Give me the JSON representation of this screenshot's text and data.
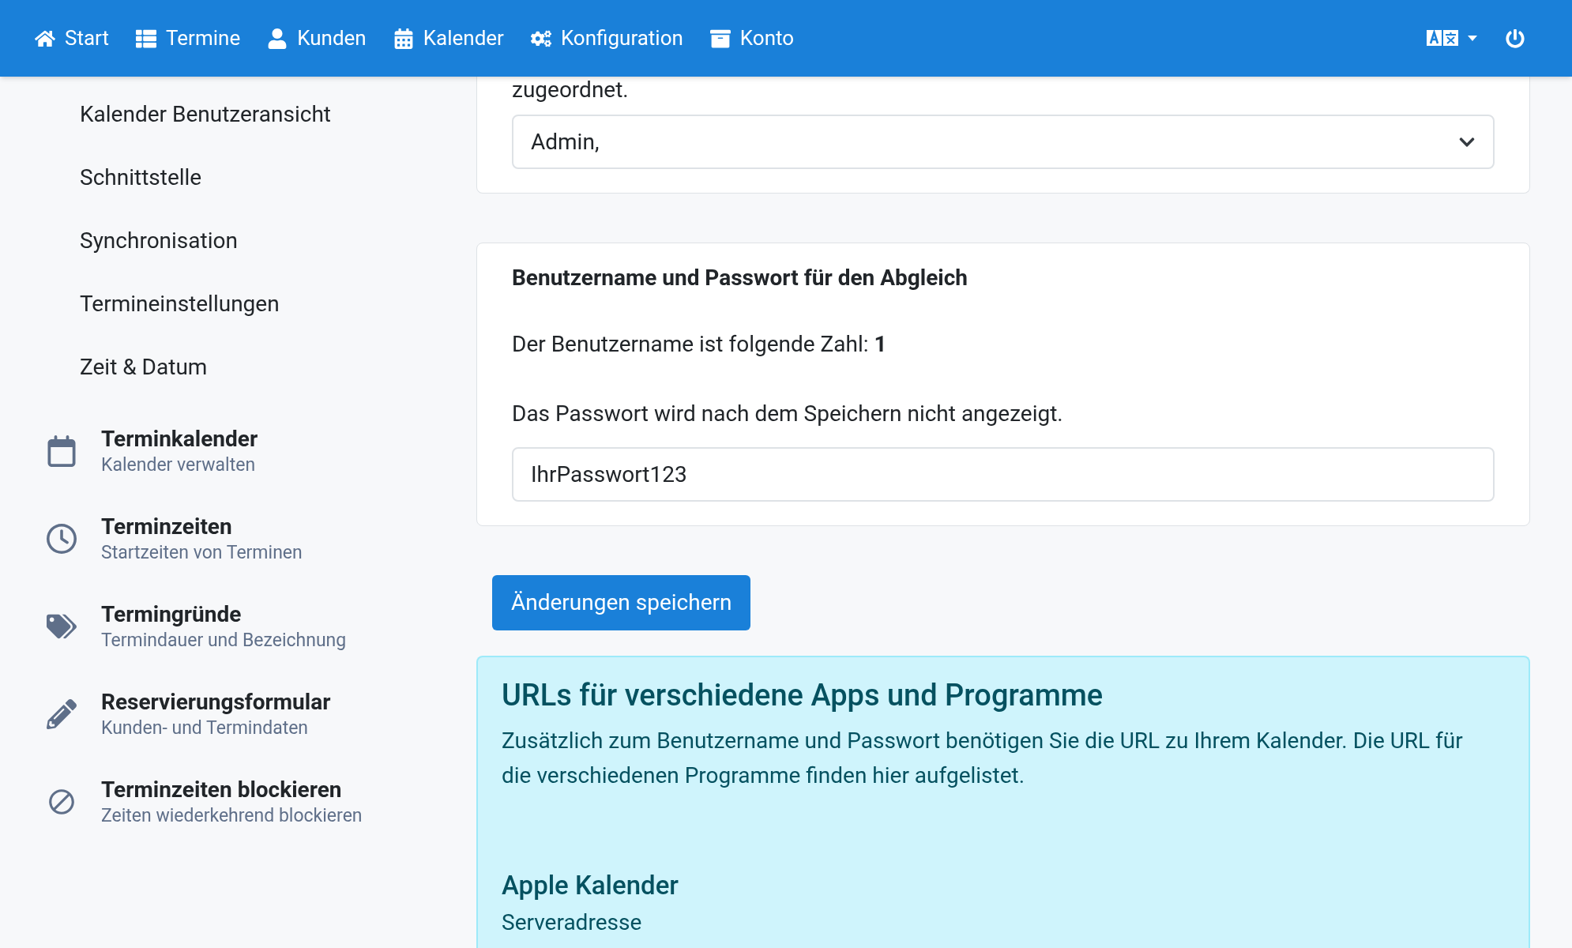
{
  "nav": {
    "items": [
      {
        "kind": "home",
        "label": "Start"
      },
      {
        "kind": "list",
        "label": "Termine"
      },
      {
        "kind": "user",
        "label": "Kunden"
      },
      {
        "kind": "calendar",
        "label": "Kalender"
      },
      {
        "kind": "gears",
        "label": "Konfiguration"
      },
      {
        "kind": "archive",
        "label": "Konto"
      }
    ]
  },
  "sidebar": {
    "subitems": [
      "Kalender Benutzeransicht",
      "Schnittstelle",
      "Synchronisation",
      "Termineinstellungen",
      "Zeit & Datum"
    ],
    "items": [
      {
        "kind": "calendar",
        "title": "Terminkalender",
        "subtitle": "Kalender verwalten"
      },
      {
        "kind": "clock",
        "title": "Terminzeiten",
        "subtitle": "Startzeiten von Terminen"
      },
      {
        "kind": "tags",
        "title": "Termingründe",
        "subtitle": "Termindauer und Bezeichnung"
      },
      {
        "kind": "pencil",
        "title": "Reservierungsformular",
        "subtitle": "Kunden- und Termindaten"
      },
      {
        "kind": "ban",
        "title": "Terminzeiten blockieren",
        "subtitle": "Zeiten wiederkehrend blockieren"
      }
    ]
  },
  "assignment_card": {
    "text": "zugeordnet.",
    "select_value": "Admin,"
  },
  "credentials_card": {
    "heading": "Benutzername und Passwort für den Abgleich",
    "username_text": "Der Benutzername ist folgende Zahl: **1**",
    "password_text": "Das Passwort wird nach dem Speichern nicht angezeigt.",
    "password_value": "IhrPasswort123"
  },
  "save_button": "Änderungen speichern",
  "info_box": {
    "heading": "URLs für verschiedene Apps und Programme",
    "text": "Zusätzlich zum Benutzername und Passwort benötigen Sie die URL zu Ihrem Kalender. Die URL für die verschiedenen Programme finden hier aufgelistet.",
    "section_heading": "Apple Kalender",
    "label": "Serveradresse"
  }
}
